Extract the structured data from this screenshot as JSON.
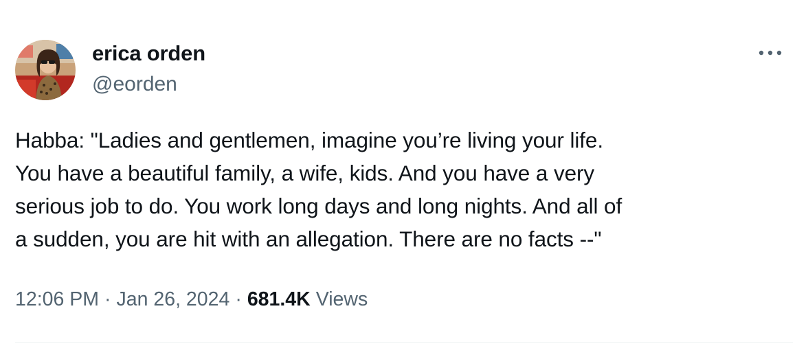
{
  "author": {
    "display_name": "erica orden",
    "handle": "@eorden"
  },
  "tweet": {
    "text": "Habba: \"Ladies and gentlemen, imagine you’re living your life.\nYou have a beautiful family, a wife, kids. And you have a very\nserious job to do. You work long days and long nights. And all of\na sudden, you are hit with an allegation. There are no facts --\"",
    "time": "12:06 PM",
    "separator": "·",
    "date": "Jan 26, 2024",
    "views_count": "681.4K",
    "views_label": "Views"
  },
  "icons": {
    "more": "more-horizontal-icon"
  },
  "colors": {
    "text_primary": "#0f1419",
    "text_secondary": "#536471",
    "divider": "#eff3f4"
  }
}
